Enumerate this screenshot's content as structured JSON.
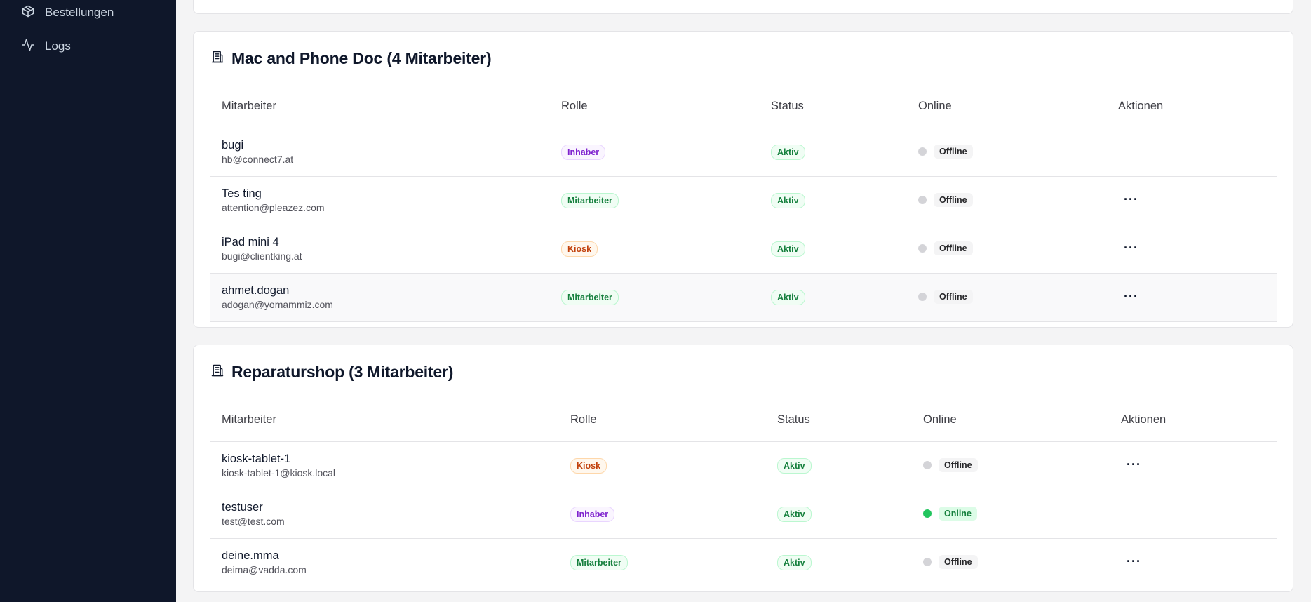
{
  "sidebar": {
    "items": [
      {
        "label": "Bestellungen",
        "icon": "package-icon"
      },
      {
        "label": "Logs",
        "icon": "activity-icon"
      }
    ]
  },
  "shops": [
    {
      "title": "Mac and Phone Doc (4 Mitarbeiter)",
      "columns": [
        "Mitarbeiter",
        "Rolle",
        "Status",
        "Online",
        "Aktionen"
      ],
      "rows": [
        {
          "name": "bugi",
          "email": "hb@connect7.at",
          "role": "Inhaber",
          "status": "Aktiv",
          "online": "Offline",
          "actions": false
        },
        {
          "name": "Tes ting",
          "email": "attention@pleazez.com",
          "role": "Mitarbeiter",
          "status": "Aktiv",
          "online": "Offline",
          "actions": true
        },
        {
          "name": "iPad mini 4",
          "email": "bugi@clientking.at",
          "role": "Kiosk",
          "status": "Aktiv",
          "online": "Offline",
          "actions": true
        },
        {
          "name": "ahmet.dogan",
          "email": "adogan@yomammiz.com",
          "role": "Mitarbeiter",
          "status": "Aktiv",
          "online": "Offline",
          "actions": true
        }
      ]
    },
    {
      "title": "Reparaturshop (3 Mitarbeiter)",
      "columns": [
        "Mitarbeiter",
        "Rolle",
        "Status",
        "Online",
        "Aktionen"
      ],
      "rows": [
        {
          "name": "kiosk-tablet-1",
          "email": "kiosk-tablet-1@kiosk.local",
          "role": "Kiosk",
          "status": "Aktiv",
          "online": "Offline",
          "actions": true
        },
        {
          "name": "testuser",
          "email": "test@test.com",
          "role": "Inhaber",
          "status": "Aktiv",
          "online": "Online",
          "actions": false
        },
        {
          "name": "deine.mma",
          "email": "deima@vadda.com",
          "role": "Mitarbeiter",
          "status": "Aktiv",
          "online": "Offline",
          "actions": true
        }
      ]
    }
  ],
  "actions_icon": "more-horizontal-icon",
  "actions_glyph": "···",
  "colors": {
    "sidebar_bg": "#0f172a",
    "inhaber": "#7e22ce",
    "mitarbeiter": "#15803d",
    "kiosk": "#c2410c",
    "online_dot": "#22c55e",
    "offline_dot": "#d4d4d8"
  }
}
